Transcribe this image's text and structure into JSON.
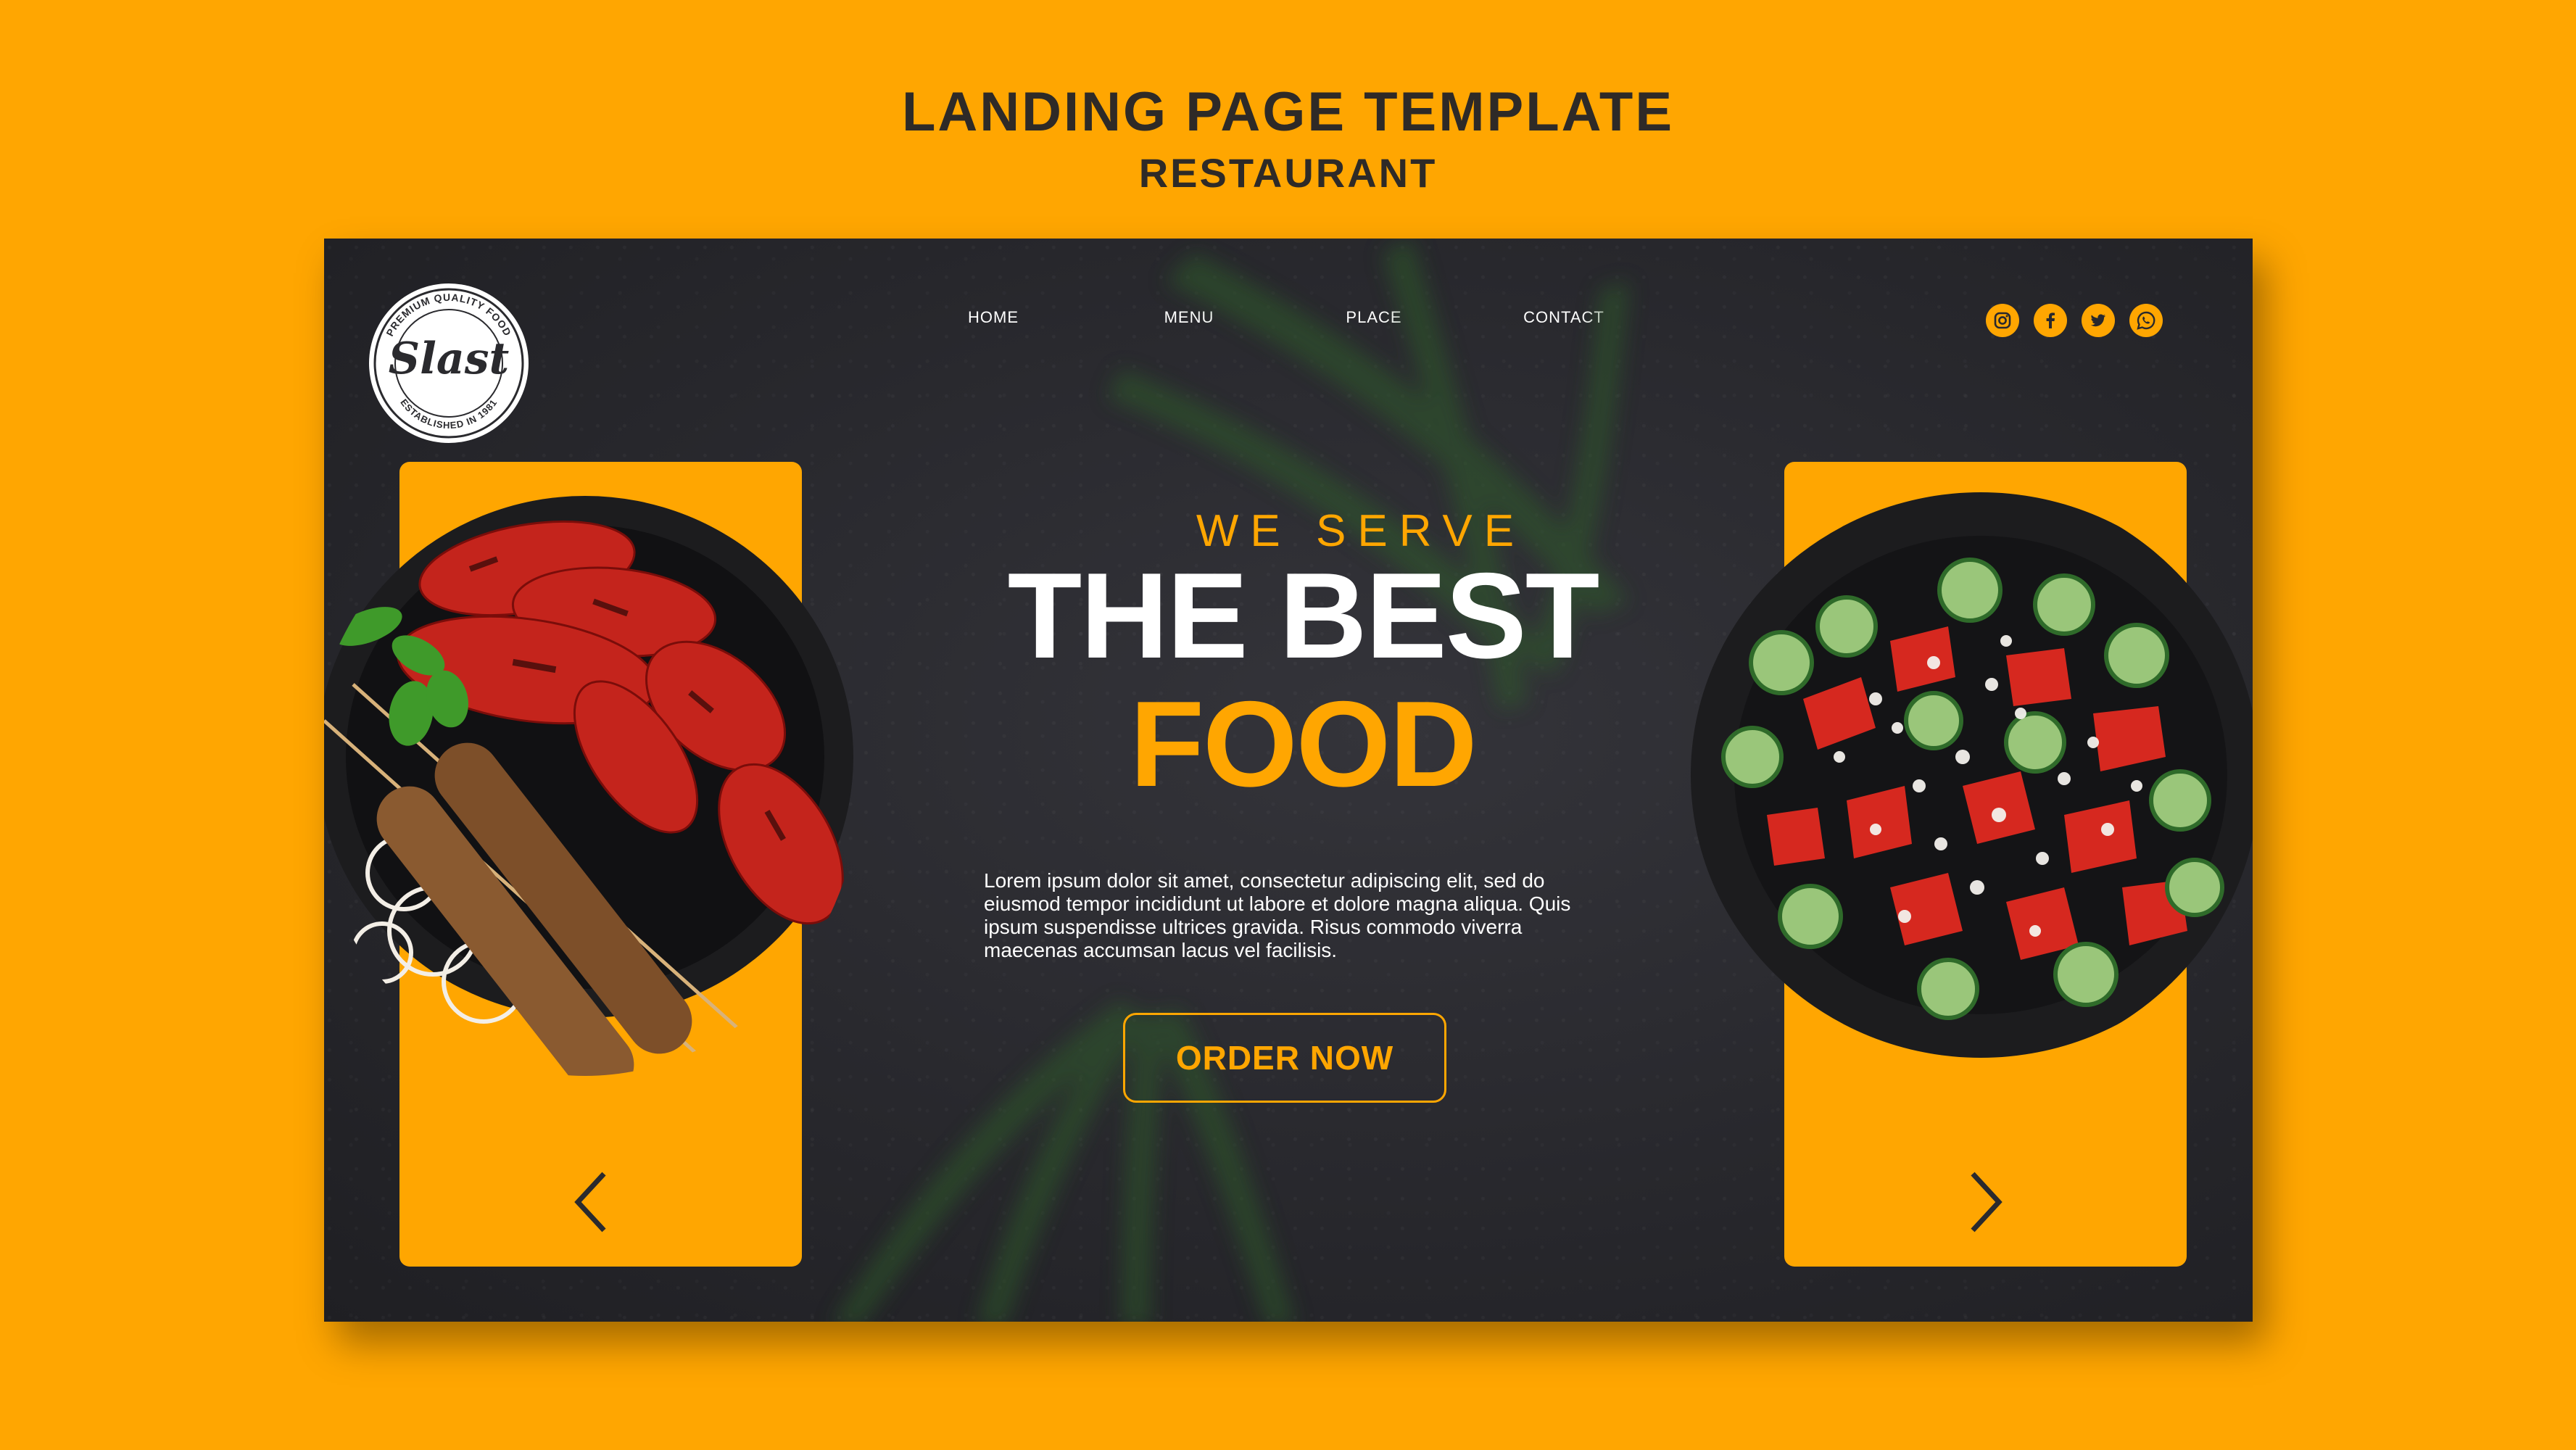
{
  "page": {
    "title_line1": "LANDING PAGE TEMPLATE",
    "title_line2": "RESTAURANT"
  },
  "brand": {
    "logo_text": "Slast",
    "logo_top_arc": "PREMIUM QUALITY FOOD",
    "logo_bottom_arc": "ESTABLISHED IN 1981"
  },
  "nav": {
    "items": [
      {
        "label": "HOME"
      },
      {
        "label": "MENU"
      },
      {
        "label": "PLACE"
      },
      {
        "label": "CONTACT"
      }
    ]
  },
  "social": {
    "icons": [
      "instagram-icon",
      "facebook-icon",
      "twitter-icon",
      "whatsapp-icon"
    ]
  },
  "hero": {
    "eyebrow": "WE SERVE",
    "headline_line1": "THE BEST",
    "headline_line2": "FOOD",
    "body": "Lorem ipsum dolor sit amet, consectetur adipiscing elit, sed do eiusmod tempor incididunt ut labore et dolore magna aliqua. Quis ipsum suspendisse ultrices gravida. Risus commodo viverra maecenas accumsan lacus vel facilisis.",
    "cta_label": "ORDER NOW"
  },
  "colors": {
    "accent": "#FFA601",
    "background_dark": "#28282d",
    "text_light": "#ffffff",
    "heading_dark": "#2e2a27"
  }
}
